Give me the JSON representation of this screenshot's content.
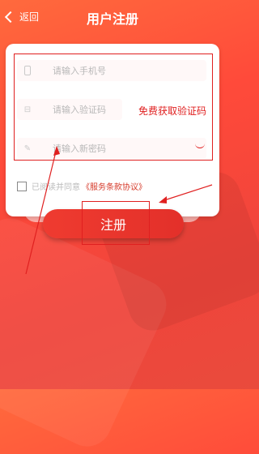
{
  "header": {
    "back_label": "返回",
    "title": "用户注册"
  },
  "form": {
    "phone_placeholder": "请输入手机号",
    "code_placeholder": "请输入验证码",
    "get_code_label": "免费获取验证码",
    "password_placeholder": "请输入新密码"
  },
  "agreement": {
    "prefix": "已阅读并同意",
    "link_label": "《服务条款协议》"
  },
  "actions": {
    "register_label": "注册"
  },
  "colors": {
    "accent": "#e02020",
    "background_start": "#ff6a3d",
    "background_end": "#e94b3c",
    "button": "#ef3b30"
  },
  "icons": [
    "chevron-left-icon",
    "phone-icon",
    "shield-icon",
    "pencil-icon",
    "eye-icon"
  ]
}
